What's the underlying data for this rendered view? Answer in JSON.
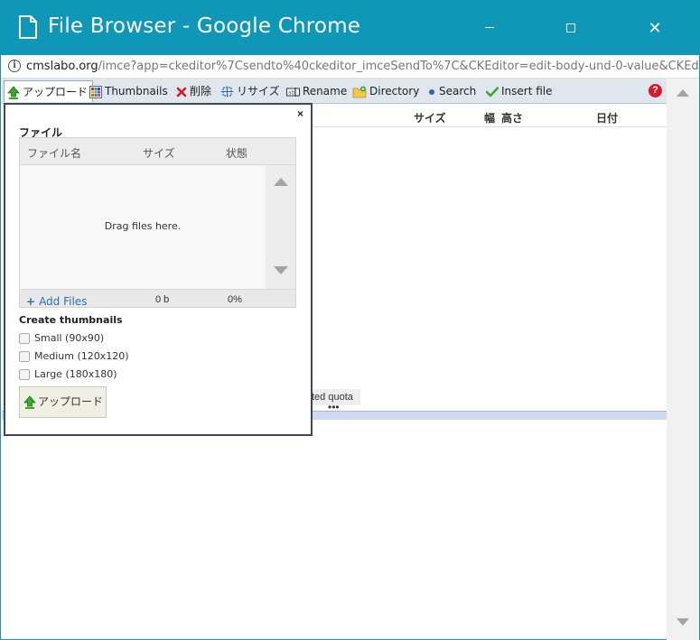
{
  "window": {
    "title": "File Browser - Google Chrome",
    "close_glyph": "✕"
  },
  "address": {
    "domain": "cmslabo.org",
    "path": "/imce?app=ckeditor%7Csendto%40ckeditor_imceSendTo%7C&CKEditor=edit-body-und-0-value&CKEditor"
  },
  "toolbar": {
    "upload": "アップロード",
    "thumbnails": "Thumbnails",
    "delete": "削除",
    "resize": "リサイズ",
    "rename": "Rename",
    "directory": "Directory",
    "search": "Search",
    "insert": "Insert file",
    "help": "?"
  },
  "list_header": {
    "size": "サイズ",
    "width": "幅",
    "height": "高さ",
    "date": "日付"
  },
  "quota": "ted quota",
  "divider_dots": "•••",
  "upload_panel": {
    "close": "×",
    "title": "ファイル",
    "columns": {
      "filename": "ファイル名",
      "size": "サイズ",
      "status": "状態"
    },
    "drag_text": "Drag files here.",
    "add_files": "Add Files",
    "add_plus": "+",
    "total_size": "0 b",
    "progress": "0%",
    "thumbnails_title": "Create thumbnails",
    "thumb_options": [
      "Small (90x90)",
      "Medium (120x120)",
      "Large (180x180)"
    ],
    "upload_button": "アップロード"
  },
  "colors": {
    "titlebar": "#0f97b8",
    "toolbar": "#dfe6ee",
    "divider": "#cfd9f4",
    "link": "#2a6fb8",
    "help": "#d9182a"
  }
}
